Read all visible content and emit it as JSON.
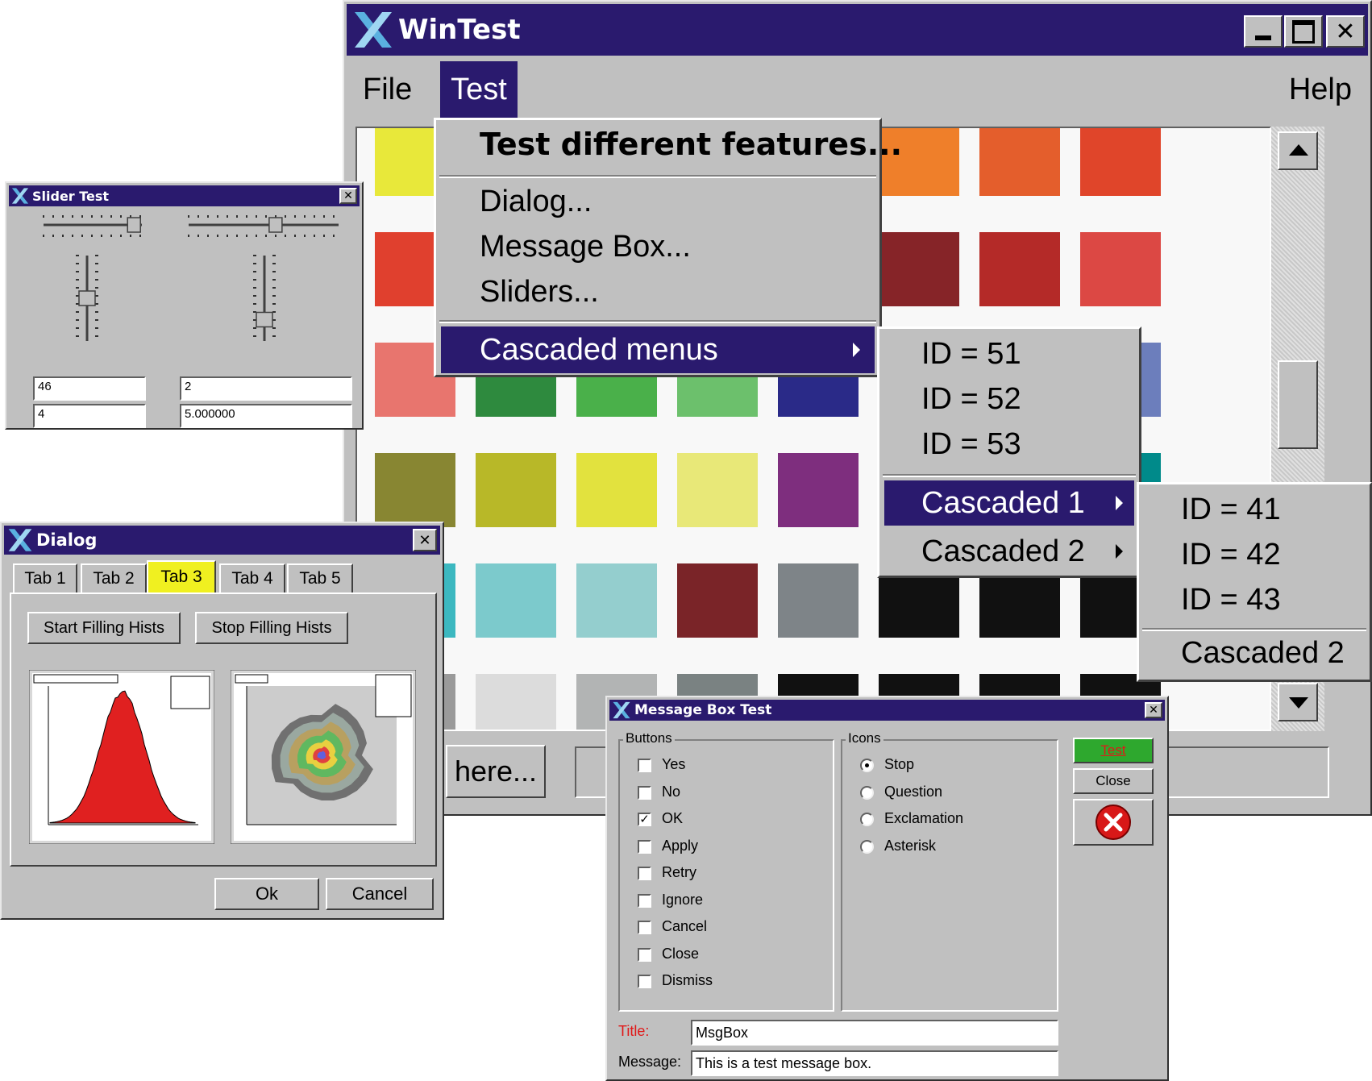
{
  "wintest": {
    "title": "WinTest",
    "menu": {
      "file": "File",
      "test": "Test",
      "help": "Help"
    },
    "test_menu": {
      "header": "Test different features...",
      "items": [
        "Dialog...",
        "Message Box...",
        "Sliders..."
      ],
      "cascaded": "Cascaded menus"
    },
    "cascade_menu": {
      "items": [
        "ID = 51",
        "ID = 52",
        "ID = 53"
      ],
      "sub": [
        "Cascaded 1",
        "Cascaded 2"
      ]
    },
    "cascade1_menu": {
      "items": [
        "ID = 41",
        "ID = 42",
        "ID = 43"
      ],
      "sub": "Cascaded 2"
    },
    "bottom_button": "here...",
    "swatches": [
      [
        "#e8e83a",
        "#f0a040",
        "#f0a040",
        "#f0a040",
        "#e8893a",
        "#ef7f2a",
        "#e45e2c",
        "#e0452a"
      ],
      [
        "#e0402e",
        "#d8d8d8",
        "#d8d8d8",
        "#d8d8d8",
        "#d0d2d0",
        "#862428",
        "#b42a28",
        "#dc4844"
      ],
      [
        "#e8756e",
        "#2e8a3e",
        "#4ab04a",
        "#6cc06c",
        "#2a2a88",
        "#2f3583",
        "#4b5aa6",
        "#6c7ebc"
      ],
      [
        "#888632",
        "#b8b828",
        "#e2e23e",
        "#e8e878",
        "#7e2e7e",
        "#7e2e7e",
        "#c88ac6",
        "#008a8a"
      ],
      [
        "#3cb8c0",
        "#7ccacc",
        "#94cece",
        "#7a2428",
        "#7e8488",
        "#111111",
        "#111111",
        "#111111"
      ],
      [
        "#9a9a9a",
        "#dcdcdc",
        "#b2b4b4",
        "#7a8282",
        "#111111",
        "#111111",
        "#111111",
        "#111111"
      ]
    ]
  },
  "slider": {
    "title": "Slider Test",
    "fields": [
      "46",
      "2",
      "4",
      "5.000000"
    ],
    "levels": {
      "h1": 0.92,
      "h2": 0.58,
      "v1": 0.5,
      "v2": 0.75
    }
  },
  "dialog": {
    "title": "Dialog",
    "tabs": [
      "Tab 1",
      "Tab 2",
      "Tab 3",
      "Tab 4",
      "Tab 5"
    ],
    "active_tab": 2,
    "start_btn": "Start Filling Hists",
    "stop_btn": "Stop Filling Hists",
    "ok": "Ok",
    "cancel": "Cancel"
  },
  "msgbox": {
    "title": "Message Box Test",
    "buttons_label": "Buttons",
    "icons_label": "Icons",
    "buttons": [
      {
        "label": "Yes",
        "checked": false
      },
      {
        "label": "No",
        "checked": false
      },
      {
        "label": "OK",
        "checked": true
      },
      {
        "label": "Apply",
        "checked": false
      },
      {
        "label": "Retry",
        "checked": false
      },
      {
        "label": "Ignore",
        "checked": false
      },
      {
        "label": "Cancel",
        "checked": false
      },
      {
        "label": "Close",
        "checked": false
      },
      {
        "label": "Dismiss",
        "checked": false
      }
    ],
    "icons": [
      {
        "label": "Stop",
        "selected": true
      },
      {
        "label": "Question",
        "selected": false
      },
      {
        "label": "Exclamation",
        "selected": false
      },
      {
        "label": "Asterisk",
        "selected": false
      }
    ],
    "test_btn": "Test",
    "close_btn": "Close",
    "title_label": "Title:",
    "title_value": "MsgBox",
    "message_label": "Message:",
    "message_value": "This is a test message box.",
    "colors": {
      "test_bg": "#2ea82e",
      "test_fg": "#e01818",
      "title_label": "#e01818"
    }
  }
}
